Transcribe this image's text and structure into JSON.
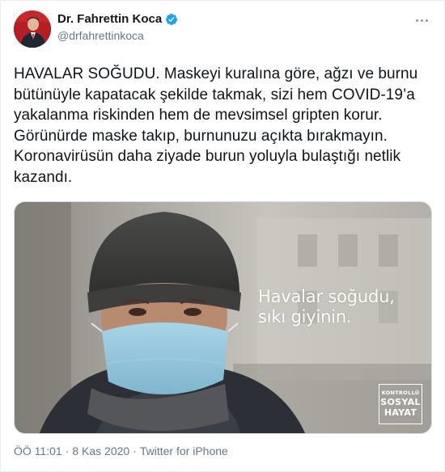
{
  "author": {
    "display_name": "Dr. Fahrettin Koca",
    "handle": "@drfahrettinkoca",
    "verified": true,
    "avatar_bg": "#b51e22"
  },
  "tweet": {
    "text": "HAVALAR SOĞUDU. Maskeyi kuralına göre, ağzı ve burnu bütünüyle kapatacak şekilde takmak, sizi hem COVID-19’a yakalanma riskinden hem de mevsimsel gripten korur. Görünürde maske takıp, burnunuzu açıkta bırakmayın. Koronavirüsün daha ziyade burun yoluyla bulaştığı netlik kazandı."
  },
  "media": {
    "caption_line1": "Havalar soğudu,",
    "caption_line2": "sıkı giyinin.",
    "logo_line1": "KONTROLLÜ",
    "logo_line2": "SOSYAL",
    "logo_line3": "HAYAT"
  },
  "meta": {
    "time": "ÖÖ 11:01",
    "sep1": "·",
    "date": "8 Kas 2020",
    "sep2": "·",
    "source": "Twitter for iPhone"
  },
  "icons": {
    "more": "more-options-icon",
    "verified": "verified-badge-icon"
  },
  "colors": {
    "verified_blue": "#1da1f2",
    "secondary_text": "#657786"
  }
}
